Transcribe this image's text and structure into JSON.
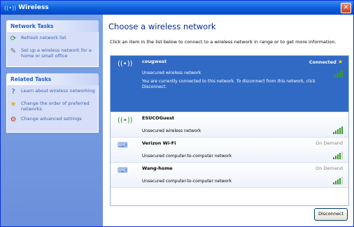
{
  "window": {
    "title": "Wireless",
    "close_glyph": "✕"
  },
  "sidebar": {
    "network_tasks": {
      "title": "Network Tasks",
      "items": [
        {
          "label": "Refresh network list",
          "icon": "refresh-icon"
        },
        {
          "label": "Set up a wireless network for a home or small office",
          "icon": "setup-network-icon"
        }
      ]
    },
    "related_tasks": {
      "title": "Related Tasks",
      "items": [
        {
          "label": "Learn about wireless networking",
          "icon": "help-icon"
        },
        {
          "label": "Change the order of preferred networks",
          "icon": "star-icon"
        },
        {
          "label": "Change advanced settings",
          "icon": "settings-icon"
        }
      ]
    }
  },
  "main": {
    "heading": "Choose a wireless network",
    "instructions": "Click an item in the list below to connect to a wireless network in range or to get more information.",
    "networks": [
      {
        "name": "cougwest",
        "status": "Connected",
        "security": "Unsecured wireless network",
        "message": "You are currently connected to this network. To disconnect from this network, click Disconnect.",
        "signal": 5,
        "icon": "wireless-network-icon"
      },
      {
        "name": "ESUCOGuest",
        "status": "",
        "security": "Unsecured wireless network",
        "signal": 5,
        "icon": "wireless-network-icon"
      },
      {
        "name": "Verizon Wi-Fi",
        "status": "On Demand",
        "security": "Unsecured computer-to-computer network",
        "signal": 4,
        "icon": "computer-to-computer-icon"
      },
      {
        "name": "Wang-home",
        "status": "On Demand",
        "security": "Unsecured computer-to-computer network",
        "signal": 4,
        "icon": "computer-to-computer-icon"
      }
    ],
    "disconnect_label": "Disconnect"
  }
}
